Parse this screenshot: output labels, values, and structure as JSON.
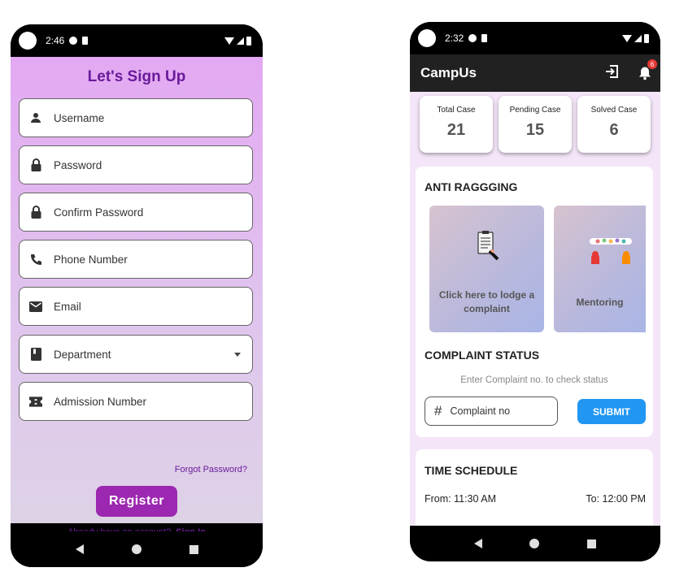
{
  "signup": {
    "status_time": "2:46",
    "title": "Let's Sign Up",
    "fields": [
      {
        "label": "Username",
        "icon": "person-icon"
      },
      {
        "label": "Password",
        "icon": "lock-icon"
      },
      {
        "label": "Confirm Password",
        "icon": "lock-icon"
      },
      {
        "label": "Phone Number",
        "icon": "phone-icon"
      },
      {
        "label": "Email",
        "icon": "email-icon"
      },
      {
        "label": "Department",
        "icon": "book-icon"
      },
      {
        "label": "Admission Number",
        "icon": "ticket-icon"
      }
    ],
    "forgot_password": "Forgot Password?",
    "register_label": "Register",
    "already_text": "Already have an account?",
    "sign_in_label": "Sign In"
  },
  "campus": {
    "status_time": "2:32",
    "app_title": "CampUs",
    "notification_count": "6",
    "stats": [
      {
        "label": "Total Case",
        "value": "21"
      },
      {
        "label": "Pending Case",
        "value": "15"
      },
      {
        "label": "Solved Case",
        "value": "6"
      }
    ],
    "anti_ragging_title": "ANTI RAGGGING",
    "cards": [
      {
        "label": "Click here to lodge a complaint"
      },
      {
        "label": "Mentoring"
      }
    ],
    "complaint_status_title": "COMPLAINT STATUS",
    "complaint_hint": "Enter Complaint no. to check status",
    "complaint_placeholder": "Complaint no",
    "submit_label": "SUBMIT",
    "time_schedule_title": "TIME SCHEDULE",
    "from_text": "From: 11:30 AM",
    "to_text": "To: 12:00 PM"
  },
  "colors": {
    "accent_purple": "#9c27b0",
    "title_purple": "#6a1b9a",
    "submit_blue": "#2196f3",
    "appbar_dark": "#212121"
  }
}
